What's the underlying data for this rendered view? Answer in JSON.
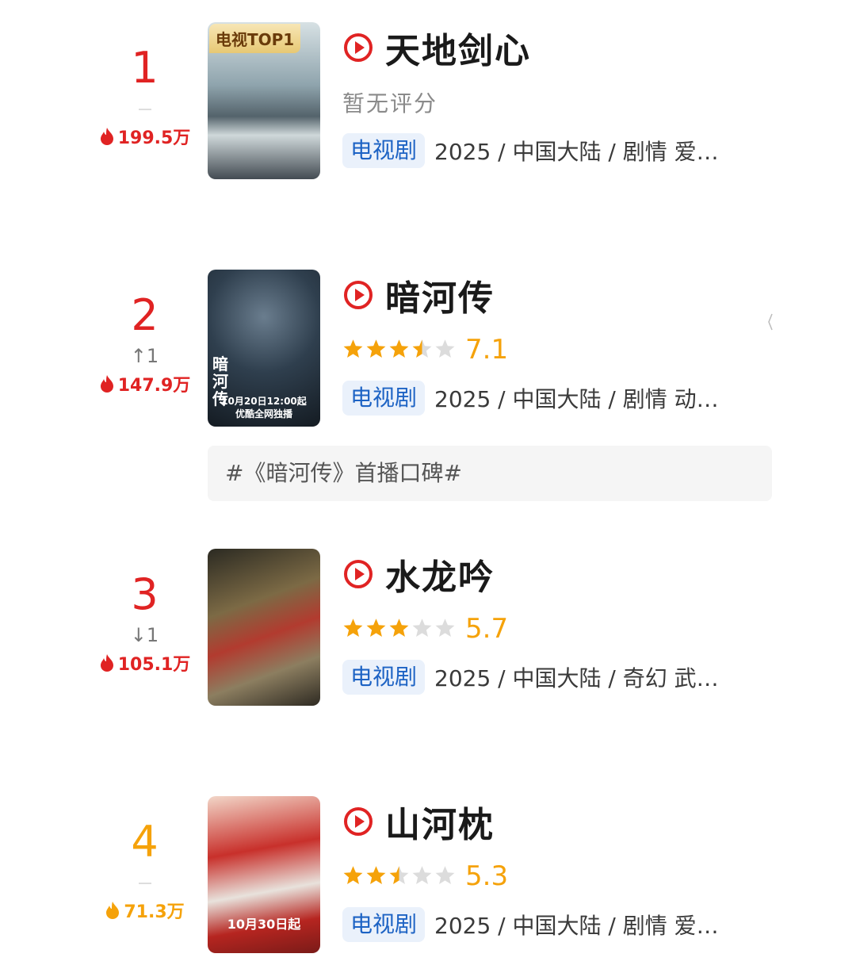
{
  "colors": {
    "rank_red": "#e02323",
    "rank_orange": "#f5a20a",
    "star_on": "#f5a20a",
    "star_off": "#dcdcdc",
    "tag_bg": "#eaf1fb",
    "tag_text": "#1d63c4"
  },
  "items": [
    {
      "rank": "1",
      "trend": "",
      "heat": "199.5万",
      "badge": "电视TOP1",
      "title": "天地剑心",
      "no_score": "暂无评分",
      "rating": null,
      "score": "",
      "tag": "电视剧",
      "meta": "2025 / 中国大陆 / 剧情 爱…",
      "poster_caption": ""
    },
    {
      "rank": "2",
      "trend": "↑1",
      "heat": "147.9万",
      "badge": "",
      "title": "暗河传",
      "no_score": "",
      "rating": 3.5,
      "score": "7.1",
      "tag": "电视剧",
      "meta": "2025 / 中国大陆 / 剧情 动…",
      "poster_caption": "10月20日12:00起\n优酷全网独播",
      "poster_vertical": "暗河传"
    },
    {
      "rank": "3",
      "trend": "↓1",
      "heat": "105.1万",
      "badge": "",
      "title": "水龙吟",
      "no_score": "",
      "rating": 3,
      "score": "5.7",
      "tag": "电视剧",
      "meta": "2025 / 中国大陆 / 奇幻 武…",
      "poster_caption": ""
    },
    {
      "rank": "4",
      "trend": "",
      "heat": "71.3万",
      "badge": "",
      "title": "山河枕",
      "no_score": "",
      "rating": 2.5,
      "score": "5.3",
      "tag": "电视剧",
      "meta": "2025 / 中国大陆 / 剧情 爱…",
      "poster_caption": "10月30日起"
    }
  ],
  "hashtag": "#《暗河传》首播口碑#",
  "icons": {
    "play": "play-circle-icon",
    "flame": "flame-icon",
    "star": "star-icon"
  }
}
